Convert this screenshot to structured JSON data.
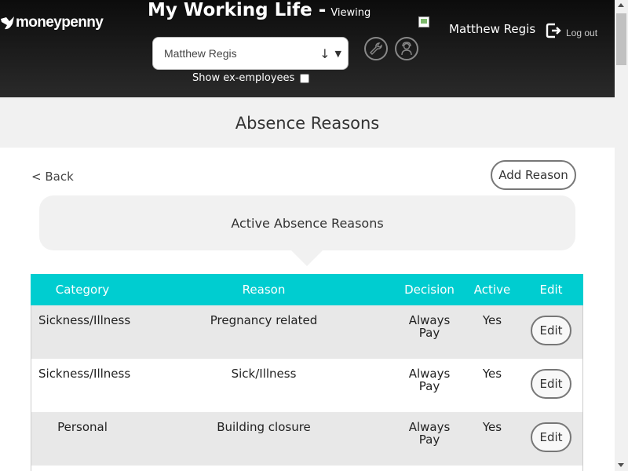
{
  "header": {
    "logo_text": "moneypenny",
    "app_title": "My Working Life -",
    "viewing_label": "Viewing",
    "employee_select": {
      "value": "Matthew Regis"
    },
    "show_ex_employees_label": "Show ex-employees",
    "user_name": "Matthew Regis",
    "logout_label": "Log out"
  },
  "page": {
    "title": "Absence Reasons",
    "back_label": "< Back",
    "add_reason_label": "Add Reason",
    "section_title": "Active Absence Reasons"
  },
  "table": {
    "columns": [
      "Category",
      "Reason",
      "Decision",
      "Active",
      "Edit"
    ],
    "rows": [
      {
        "category": "Sickness/Illness",
        "reason": "Pregnancy related",
        "decision_line1": "Always",
        "decision_line2": "Pay",
        "active": "Yes",
        "edit": "Edit"
      },
      {
        "category": "Sickness/Illness",
        "reason": "Sick/Illness",
        "decision_line1": "Always",
        "decision_line2": "Pay",
        "active": "Yes",
        "edit": "Edit"
      },
      {
        "category": "Personal",
        "reason": "Building closure",
        "decision_line1": "Always",
        "decision_line2": "Pay",
        "active": "Yes",
        "edit": "Edit"
      }
    ]
  },
  "colors": {
    "header_bg": "#111111",
    "table_header": "#00cdd0",
    "row_alt": "#e8e8e8",
    "band_bg": "#f1f1f1"
  },
  "icons": [
    "moneypenny-bird-icon",
    "wrench-icon",
    "support-person-icon",
    "broken-image-icon",
    "logout-icon",
    "arrow-down-icon",
    "chevron-down-icon"
  ]
}
